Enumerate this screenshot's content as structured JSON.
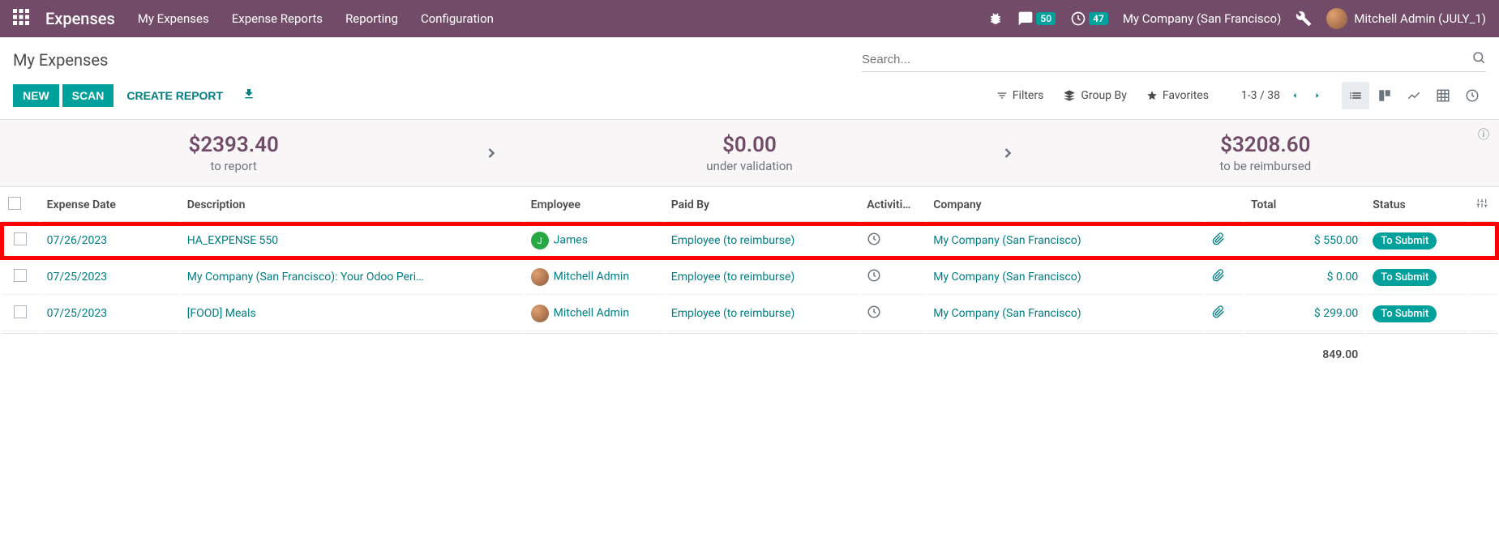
{
  "navbar": {
    "brand": "Expenses",
    "menu": [
      "My Expenses",
      "Expense Reports",
      "Reporting",
      "Configuration"
    ],
    "msg_badge": "50",
    "activity_badge": "47",
    "company": "My Company (San Francisco)",
    "user": "Mitchell Admin (JULY_1)"
  },
  "breadcrumb": "My Expenses",
  "buttons": {
    "new": "NEW",
    "scan": "SCAN",
    "create_report": "CREATE REPORT"
  },
  "search": {
    "placeholder": "Search..."
  },
  "search_opts": {
    "filters": "Filters",
    "groupby": "Group By",
    "favorites": "Favorites"
  },
  "pager": {
    "range": "1-3 / 38"
  },
  "dashboard": {
    "to_report_amount": "$2393.40",
    "to_report_label": "to report",
    "under_val_amount": "$0.00",
    "under_val_label": "under validation",
    "to_reimburse_amount": "$3208.60",
    "to_reimburse_label": "to be reimbursed"
  },
  "columns": {
    "date": "Expense Date",
    "desc": "Description",
    "emp": "Employee",
    "paid": "Paid By",
    "act": "Activiti…",
    "company": "Company",
    "total": "Total",
    "status": "Status"
  },
  "rows": [
    {
      "date": "07/26/2023",
      "desc": "HA_EXPENSE 550",
      "emp": "James",
      "emp_initial": "J",
      "emp_avatar": "green",
      "paid": "Employee (to reimburse)",
      "company": "My Company (San Francisco)",
      "total": "$ 550.00",
      "status": "To Submit",
      "highlight": true
    },
    {
      "date": "07/25/2023",
      "desc": "My Company (San Francisco): Your Odoo Peri…",
      "emp": "Mitchell Admin",
      "emp_initial": "",
      "emp_avatar": "photo",
      "paid": "Employee (to reimburse)",
      "company": "My Company (San Francisco)",
      "total": "$ 0.00",
      "status": "To Submit",
      "highlight": false
    },
    {
      "date": "07/25/2023",
      "desc": "[FOOD] Meals",
      "emp": "Mitchell Admin",
      "emp_initial": "",
      "emp_avatar": "photo",
      "paid": "Employee (to reimburse)",
      "company": "My Company (San Francisco)",
      "total": "$ 299.00",
      "status": "To Submit",
      "highlight": false
    }
  ],
  "footer_total": "849.00"
}
